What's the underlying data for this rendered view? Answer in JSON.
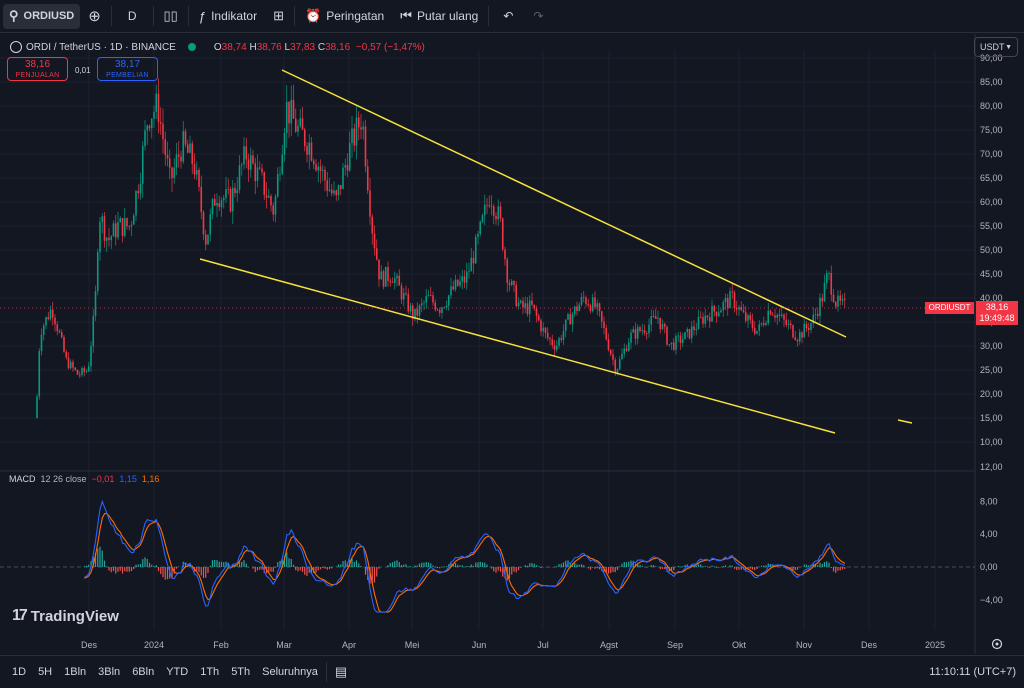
{
  "toolbar": {
    "symbol": "ORDIUSD",
    "interval": "D",
    "indicators_label": "Indikator",
    "alerts_label": "Peringatan",
    "replay_label": "Putar ulang"
  },
  "legend": {
    "title": "ORDI / TetherUS · 1D · BINANCE",
    "open_k": "O",
    "open_v": "38,74",
    "high_k": "H",
    "high_v": "38,76",
    "low_k": "L",
    "low_v": "37,83",
    "close_k": "C",
    "close_v": "38,16",
    "change": "−0,57 (−1,47%)"
  },
  "trade": {
    "sell_price": "38,16",
    "sell_label": "PENJUALAN",
    "spread": "0,01",
    "buy_price": "38,17",
    "buy_label": "PEMBELIAN"
  },
  "currency_button": "USDT",
  "price_scale": {
    "labels": [
      "90,00",
      "85,00",
      "80,00",
      "75,00",
      "70,00",
      "65,00",
      "60,00",
      "55,00",
      "50,00",
      "45,00",
      "40,00",
      "35,00",
      "30,00",
      "25,00",
      "20,00",
      "15,00",
      "10,00"
    ],
    "values": [
      90,
      85,
      80,
      75,
      70,
      65,
      60,
      55,
      50,
      45,
      40,
      35,
      30,
      25,
      20,
      15,
      10
    ],
    "cut_label": "12,00",
    "last_symbol": "ORDIUSDT",
    "last_price": "38,16",
    "countdown": "19:49:48"
  },
  "macd": {
    "name": "MACD",
    "params": "12 26 close",
    "hist": "−0,01",
    "macd": "1,15",
    "signal": "1,16",
    "scale_labels": [
      "8,00",
      "4,00",
      "0,00",
      "−4,00"
    ],
    "scale_values": [
      8,
      4,
      0,
      -4
    ]
  },
  "time_axis": [
    "Des",
    "2024",
    "Feb",
    "Mar",
    "Apr",
    "Mei",
    "Jun",
    "Jul",
    "Agst",
    "Sep",
    "Okt",
    "Nov",
    "Des",
    "2025"
  ],
  "brand": "TradingView",
  "bottom": {
    "ranges": [
      "1D",
      "5H",
      "1Bln",
      "3Bln",
      "6Bln",
      "YTD",
      "1Th",
      "5Th",
      "Seluruhnya"
    ],
    "clock": "11:10:11 (UTC+7)"
  },
  "colors": {
    "up": "#089981",
    "down": "#f23645",
    "trend": "#f7e23a",
    "macd": "#2962ff",
    "signal": "#ff6d00",
    "bg": "#131722"
  },
  "chart_data": {
    "type": "candlestick",
    "symbol": "ORDIUSDT",
    "y_range": [
      10,
      90
    ],
    "close_series_approx": [
      {
        "month": "Des 2023",
        "low": 12,
        "high": 35
      },
      {
        "month": "Jan 2024",
        "low": 45,
        "high": 88
      },
      {
        "month": "Feb 2024",
        "low": 48,
        "high": 80
      },
      {
        "month": "Mar 2024",
        "low": 55,
        "high": 92
      },
      {
        "month": "Apr 2024",
        "low": 38,
        "high": 79
      },
      {
        "month": "Mei 2024",
        "low": 32,
        "high": 50
      },
      {
        "month": "Jun 2024",
        "low": 28,
        "high": 66
      },
      {
        "month": "Jul 2024",
        "low": 26,
        "high": 43
      },
      {
        "month": "Agst 2024",
        "low": 21,
        "high": 38
      },
      {
        "month": "Sep 2024",
        "low": 26,
        "high": 37
      },
      {
        "month": "Okt 2024",
        "low": 30,
        "high": 42
      },
      {
        "month": "Nov 2024",
        "low": 29,
        "high": 47
      }
    ],
    "last_close": 38.16
  }
}
